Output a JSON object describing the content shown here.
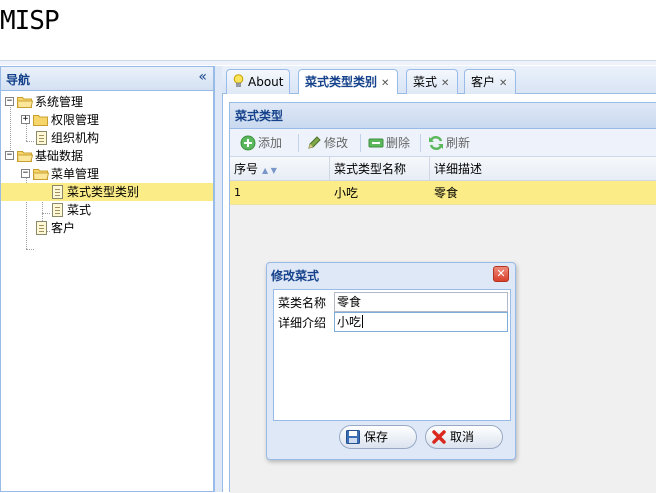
{
  "app": {
    "title": "MISP"
  },
  "nav": {
    "title": "导航",
    "collapse_icon": "double-chevron-left-icon",
    "tree": [
      {
        "label": "系统管理",
        "type": "folder",
        "expanded": true
      },
      {
        "label": "权限管理",
        "type": "folder",
        "expanded": false
      },
      {
        "label": "组织机构",
        "type": "file"
      },
      {
        "label": "基础数据",
        "type": "folder",
        "expanded": true
      },
      {
        "label": "菜单管理",
        "type": "folder",
        "expanded": true
      },
      {
        "label": "菜式类型类别",
        "type": "file",
        "selected": true
      },
      {
        "label": "菜式",
        "type": "file"
      },
      {
        "label": "客户",
        "type": "file"
      }
    ]
  },
  "tabs": [
    {
      "label": "About",
      "icon": "lightbulb-icon",
      "closable": false
    },
    {
      "label": "菜式类型类别",
      "closable": true,
      "active": true
    },
    {
      "label": "菜式",
      "closable": true
    },
    {
      "label": "客户",
      "closable": true
    }
  ],
  "grid": {
    "title": "菜式类型",
    "toolbar": {
      "add": "添加",
      "edit": "修改",
      "delete": "删除",
      "refresh": "刷新"
    },
    "columns": [
      "序号",
      "菜式类型名称",
      "详细描述"
    ],
    "rows": [
      [
        "1",
        "小吃",
        "零食"
      ]
    ]
  },
  "dialog": {
    "title": "修改菜式",
    "fields": [
      {
        "label": "菜类名称",
        "value": "零食"
      },
      {
        "label": "详细介绍",
        "value": "小吃"
      }
    ],
    "save_label": "保存",
    "cancel_label": "取消"
  },
  "colors": {
    "accent": "#15428b",
    "border": "#99bbe8",
    "selection": "#fbec88"
  }
}
